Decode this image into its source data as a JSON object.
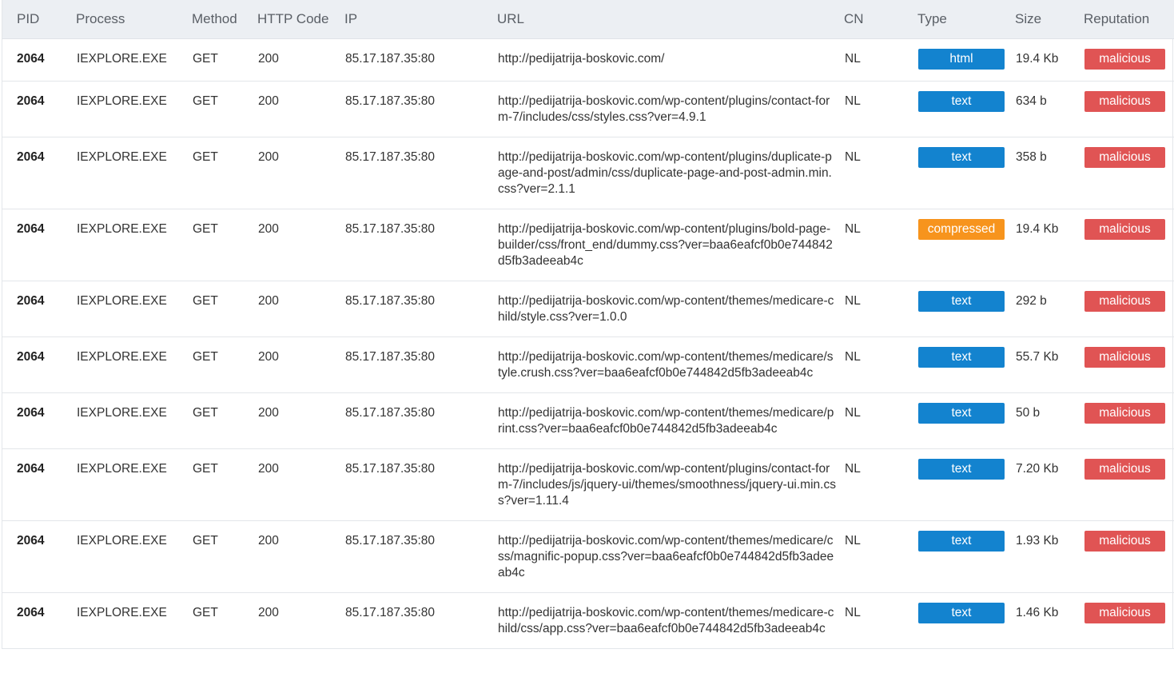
{
  "columns": {
    "pid": "PID",
    "process": "Process",
    "method": "Method",
    "http_code": "HTTP Code",
    "ip": "IP",
    "url": "URL",
    "cn": "CN",
    "type": "Type",
    "size": "Size",
    "reputation": "Reputation"
  },
  "rows": [
    {
      "pid": "2064",
      "process": "IEXPLORE.EXE",
      "method": "GET",
      "code": "200",
      "ip": "85.17.187.35:80",
      "url": "http://pedijatrija-boskovic.com/",
      "cn": "NL",
      "type": "html",
      "size": "19.4 Kb",
      "reputation": "malicious"
    },
    {
      "pid": "2064",
      "process": "IEXPLORE.EXE",
      "method": "GET",
      "code": "200",
      "ip": "85.17.187.35:80",
      "url": "http://pedijatrija-boskovic.com/wp-content/plugins/contact-form-7/includes/css/styles.css?ver=4.9.1",
      "cn": "NL",
      "type": "text",
      "size": "634 b",
      "reputation": "malicious"
    },
    {
      "pid": "2064",
      "process": "IEXPLORE.EXE",
      "method": "GET",
      "code": "200",
      "ip": "85.17.187.35:80",
      "url": "http://pedijatrija-boskovic.com/wp-content/plugins/duplicate-page-and-post/admin/css/duplicate-page-and-post-admin.min.css?ver=2.1.1",
      "cn": "NL",
      "type": "text",
      "size": "358 b",
      "reputation": "malicious"
    },
    {
      "pid": "2064",
      "process": "IEXPLORE.EXE",
      "method": "GET",
      "code": "200",
      "ip": "85.17.187.35:80",
      "url": "http://pedijatrija-boskovic.com/wp-content/plugins/bold-page-builder/css/front_end/dummy.css?ver=baa6eafcf0b0e744842d5fb3adeeab4c",
      "cn": "NL",
      "type": "compressed",
      "size": "19.4 Kb",
      "reputation": "malicious"
    },
    {
      "pid": "2064",
      "process": "IEXPLORE.EXE",
      "method": "GET",
      "code": "200",
      "ip": "85.17.187.35:80",
      "url": "http://pedijatrija-boskovic.com/wp-content/themes/medicare-child/style.css?ver=1.0.0",
      "cn": "NL",
      "type": "text",
      "size": "292 b",
      "reputation": "malicious"
    },
    {
      "pid": "2064",
      "process": "IEXPLORE.EXE",
      "method": "GET",
      "code": "200",
      "ip": "85.17.187.35:80",
      "url": "http://pedijatrija-boskovic.com/wp-content/themes/medicare/style.crush.css?ver=baa6eafcf0b0e744842d5fb3adeeab4c",
      "cn": "NL",
      "type": "text",
      "size": "55.7 Kb",
      "reputation": "malicious"
    },
    {
      "pid": "2064",
      "process": "IEXPLORE.EXE",
      "method": "GET",
      "code": "200",
      "ip": "85.17.187.35:80",
      "url": "http://pedijatrija-boskovic.com/wp-content/themes/medicare/print.css?ver=baa6eafcf0b0e744842d5fb3adeeab4c",
      "cn": "NL",
      "type": "text",
      "size": "50 b",
      "reputation": "malicious"
    },
    {
      "pid": "2064",
      "process": "IEXPLORE.EXE",
      "method": "GET",
      "code": "200",
      "ip": "85.17.187.35:80",
      "url": "http://pedijatrija-boskovic.com/wp-content/plugins/contact-form-7/includes/js/jquery-ui/themes/smoothness/jquery-ui.min.css?ver=1.11.4",
      "cn": "NL",
      "type": "text",
      "size": "7.20 Kb",
      "reputation": "malicious"
    },
    {
      "pid": "2064",
      "process": "IEXPLORE.EXE",
      "method": "GET",
      "code": "200",
      "ip": "85.17.187.35:80",
      "url": "http://pedijatrija-boskovic.com/wp-content/themes/medicare/css/magnific-popup.css?ver=baa6eafcf0b0e744842d5fb3adeeab4c",
      "cn": "NL",
      "type": "text",
      "size": "1.93 Kb",
      "reputation": "malicious"
    },
    {
      "pid": "2064",
      "process": "IEXPLORE.EXE",
      "method": "GET",
      "code": "200",
      "ip": "85.17.187.35:80",
      "url": "http://pedijatrija-boskovic.com/wp-content/themes/medicare-child/css/app.css?ver=baa6eafcf0b0e744842d5fb3adeeab4c",
      "cn": "NL",
      "type": "text",
      "size": "1.46 Kb",
      "reputation": "malicious"
    }
  ],
  "colors": {
    "header_bg": "#eceff3",
    "type_blue": "#1383cf",
    "type_orange": "#f7941d",
    "malicious_red": "#e05454"
  }
}
